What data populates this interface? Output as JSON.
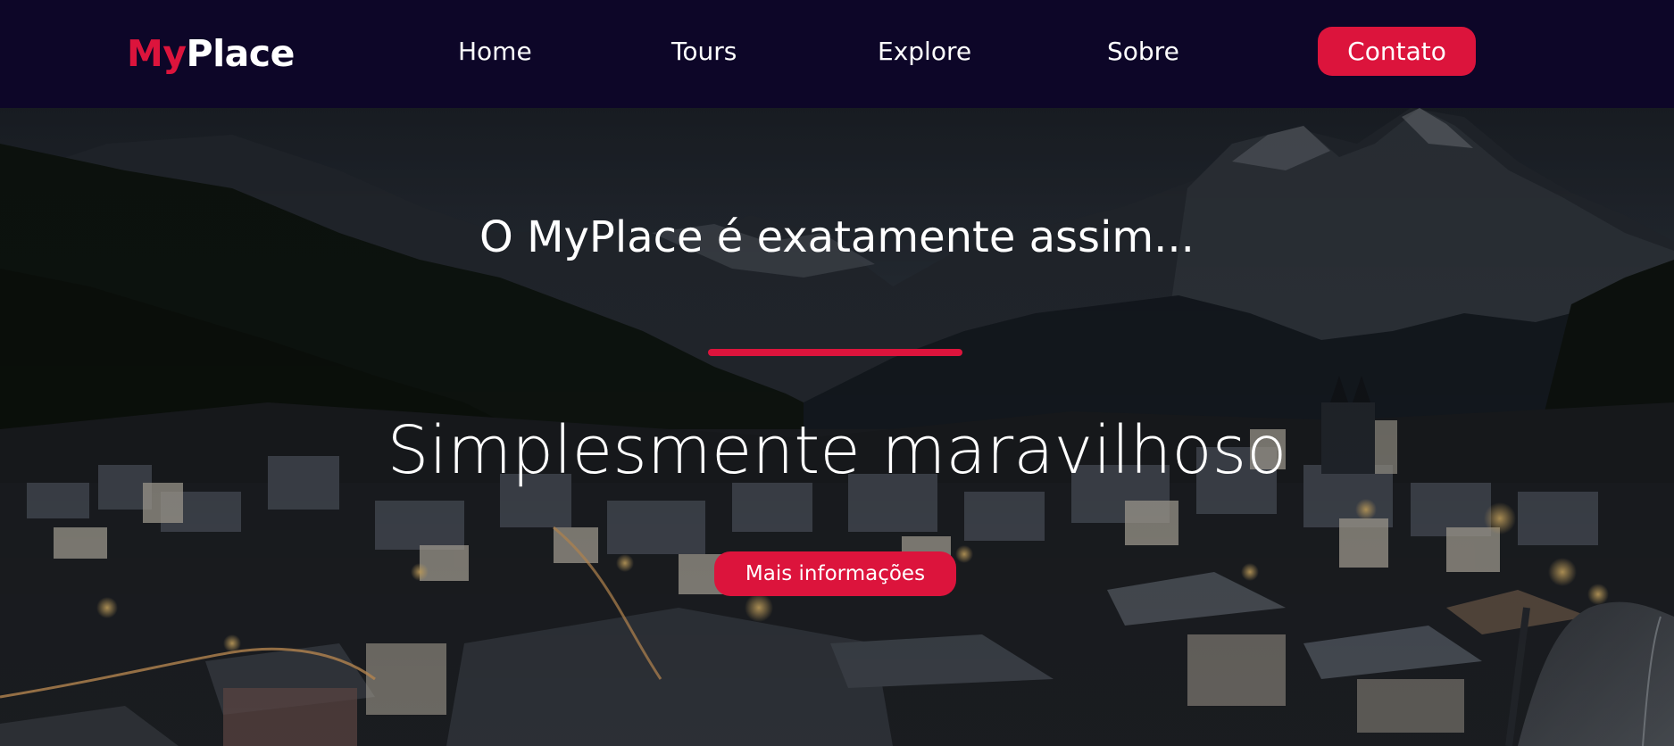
{
  "brand": {
    "logo_part1": "My",
    "logo_part2": "Place",
    "accent_color": "#dc143c",
    "nav_background": "#0d0628"
  },
  "nav": {
    "items": [
      {
        "label": "Home"
      },
      {
        "label": "Tours"
      },
      {
        "label": "Explore"
      },
      {
        "label": "Sobre"
      }
    ],
    "contact_label": "Contato"
  },
  "hero": {
    "subtitle": "O MyPlace é exatamente assim...",
    "title": "Simplesmente maravilhoso",
    "cta_label": "Mais informações",
    "background": "night-mountain-village-photo"
  }
}
